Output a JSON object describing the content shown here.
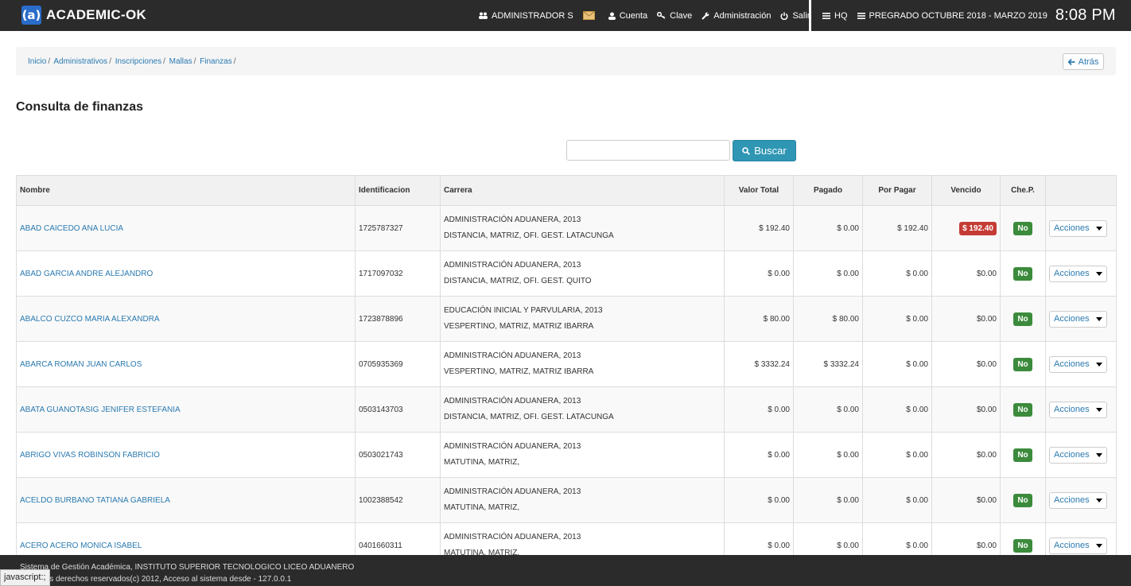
{
  "app": {
    "brand_logo": "(a)",
    "brand_name": "ACADEMIC-OK"
  },
  "nav": {
    "user": "ADMINISTRADOR S",
    "cuenta": "Cuenta",
    "clave": "Clave",
    "administracion": "Administración",
    "salir": "Salir",
    "hq": "HQ",
    "periodo": "PREGRADO OCTUBRE 2018 - MARZO 2019",
    "clock": "8:08 PM"
  },
  "breadcrumb": [
    "Inicio",
    "Administrativos",
    "Inscripciones",
    "Mallas",
    "Finanzas"
  ],
  "back_label": "Atrás",
  "page_title": "Consulta de finanzas",
  "search": {
    "placeholder": "",
    "button_label": "Buscar"
  },
  "table": {
    "headers": [
      "Nombre",
      "Identificacion",
      "Carrera",
      "Valor Total",
      "Pagado",
      "Por Pagar",
      "Vencido",
      "Che.P.",
      ""
    ],
    "rows": [
      {
        "nombre": "ABAD CAICEDO ANA LUCIA",
        "id": "1725787327",
        "carrera1": "ADMINISTRACIÓN ADUANERA, 2013",
        "carrera2": "DISTANCIA, MATRIZ, OFI. GEST. LATACUNGA",
        "total": "$ 192.40",
        "pagado": "$ 0.00",
        "por_pagar": "$ 192.40",
        "vencido": "$ 192.40",
        "vencido_alert": true,
        "chep": "No",
        "acciones": "Acciones"
      },
      {
        "nombre": "ABAD GARCIA ANDRE ALEJANDRO",
        "id": "1717097032",
        "carrera1": "ADMINISTRACIÓN ADUANERA, 2013",
        "carrera2": "DISTANCIA, MATRIZ, OFI. GEST. QUITO",
        "total": "$ 0.00",
        "pagado": "$ 0.00",
        "por_pagar": "$ 0.00",
        "vencido": "$0.00",
        "vencido_alert": false,
        "chep": "No",
        "acciones": "Acciones"
      },
      {
        "nombre": "ABALCO CUZCO MARIA ALEXANDRA",
        "id": "1723878896",
        "carrera1": "EDUCACIÓN INICIAL Y PARVULARIA, 2013",
        "carrera2": "VESPERTINO, MATRIZ, MATRIZ IBARRA",
        "total": "$ 80.00",
        "pagado": "$ 80.00",
        "por_pagar": "$ 0.00",
        "vencido": "$0.00",
        "vencido_alert": false,
        "chep": "No",
        "acciones": "Acciones"
      },
      {
        "nombre": "ABARCA ROMAN JUAN CARLOS",
        "id": "0705935369",
        "carrera1": "ADMINISTRACIÓN ADUANERA, 2013",
        "carrera2": "VESPERTINO, MATRIZ, MATRIZ IBARRA",
        "total": "$ 3332.24",
        "pagado": "$ 3332.24",
        "por_pagar": "$ 0.00",
        "vencido": "$0.00",
        "vencido_alert": false,
        "chep": "No",
        "acciones": "Acciones"
      },
      {
        "nombre": "ABATA GUANOTASIG JENIFER ESTEFANIA",
        "id": "0503143703",
        "carrera1": "ADMINISTRACIÓN ADUANERA, 2013",
        "carrera2": "DISTANCIA, MATRIZ, OFI. GEST. LATACUNGA",
        "total": "$ 0.00",
        "pagado": "$ 0.00",
        "por_pagar": "$ 0.00",
        "vencido": "$0.00",
        "vencido_alert": false,
        "chep": "No",
        "acciones": "Acciones"
      },
      {
        "nombre": "ABRIGO VIVAS ROBINSON FABRICIO",
        "id": "0503021743",
        "carrera1": "ADMINISTRACIÓN ADUANERA, 2013",
        "carrera2": "MATUTINA, MATRIZ,",
        "total": "$ 0.00",
        "pagado": "$ 0.00",
        "por_pagar": "$ 0.00",
        "vencido": "$0.00",
        "vencido_alert": false,
        "chep": "No",
        "acciones": "Acciones"
      },
      {
        "nombre": "ACELDO BURBANO TATIANA GABRIELA",
        "id": "1002388542",
        "carrera1": "ADMINISTRACIÓN ADUANERA, 2013",
        "carrera2": "MATUTINA, MATRIZ,",
        "total": "$ 0.00",
        "pagado": "$ 0.00",
        "por_pagar": "$ 0.00",
        "vencido": "$0.00",
        "vencido_alert": false,
        "chep": "No",
        "acciones": "Acciones"
      },
      {
        "nombre": "ACERO ACERO MONICA ISABEL",
        "id": "0401660311",
        "carrera1": "ADMINISTRACIÓN ADUANERA, 2013",
        "carrera2": "MATUTINA, MATRIZ,",
        "total": "$ 0.00",
        "pagado": "$ 0.00",
        "por_pagar": "$ 0.00",
        "vencido": "$0.00",
        "vencido_alert": false,
        "chep": "No",
        "acciones": "Acciones"
      }
    ]
  },
  "footer": {
    "line1": "Sistema de Gestión Académica, INSTITUTO SUPERIOR TECNOLOGICO LICEO ADUANERO",
    "line2": "Todos los derechos reservados(c) 2012, Acceso al sistema desde - 127.0.0.1"
  },
  "status_tooltip": "javascript:;",
  "colors": {
    "navbar": "#2b2b2b",
    "link": "#2a7ab0",
    "search_button": "#2f96b4",
    "danger": "#c43c35",
    "success": "#3c8b3c"
  }
}
